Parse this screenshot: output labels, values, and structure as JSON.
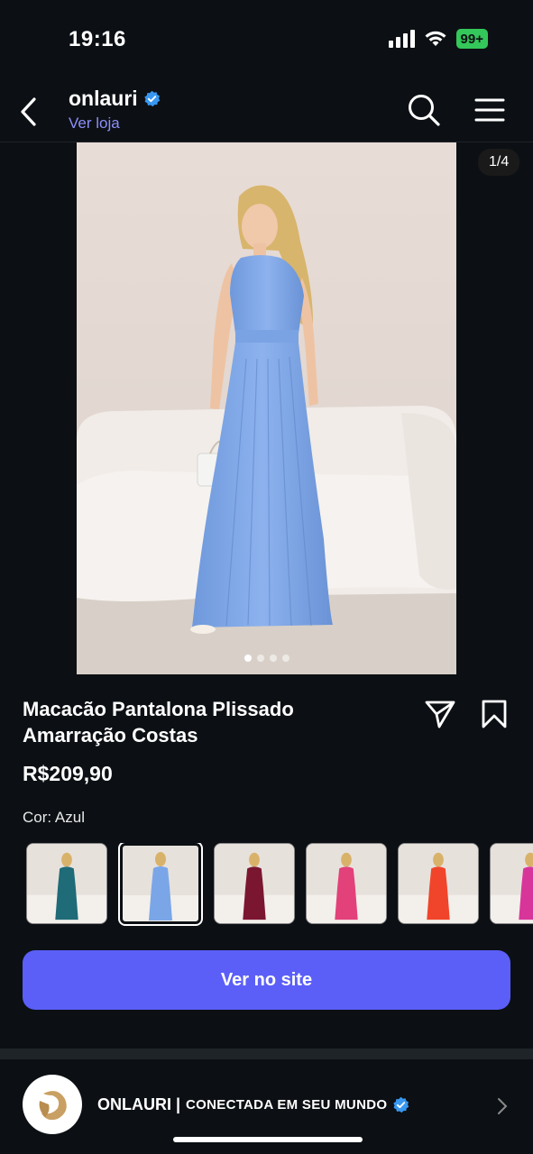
{
  "status": {
    "time": "19:16",
    "battery": "99+"
  },
  "header": {
    "account_name": "onlauri",
    "store_link": "Ver loja"
  },
  "carousel": {
    "counter": "1/4",
    "dots": 4,
    "active_dot": 1
  },
  "product": {
    "title_line1": "Macacão Pantalona Plissado",
    "title_line2": "Amarração Costas",
    "price": "R$209,90",
    "color_label": "Cor: Azul"
  },
  "swatches": [
    {
      "name": "teal",
      "color": "#1f6b78"
    },
    {
      "name": "azul",
      "color": "#7aa6e8",
      "selected": true
    },
    {
      "name": "vinho",
      "color": "#7b1631"
    },
    {
      "name": "rosa",
      "color": "#e2417a"
    },
    {
      "name": "laranja",
      "color": "#f0452a"
    },
    {
      "name": "pink",
      "color": "#d8359a"
    }
  ],
  "cta": {
    "label": "Ver no site"
  },
  "shop": {
    "name": "ONLAURI |",
    "tagline": "CONECTADA EM SEU MUNDO"
  },
  "colors": {
    "accent": "#5b5ff7",
    "link": "#8c8ff7",
    "verified": "#3897f0",
    "background": "#0c1014"
  }
}
